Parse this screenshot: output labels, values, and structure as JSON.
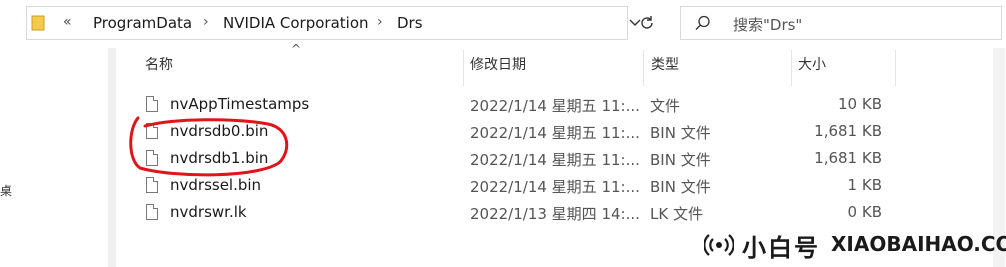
{
  "breadcrumb": {
    "overflow": "«",
    "items": [
      "ProgramData",
      "NVIDIA Corporation",
      "Drs"
    ],
    "separator": "›"
  },
  "search": {
    "placeholder": "搜索\"Drs\""
  },
  "nav": {
    "partial_label": "桌"
  },
  "columns": {
    "name": "名称",
    "date": "修改日期",
    "type": "类型",
    "size": "大小"
  },
  "files": [
    {
      "name": "nvAppTimestamps",
      "date": "2022/1/14 星期五 11:...",
      "type": "文件",
      "size": "10 KB"
    },
    {
      "name": "nvdrsdb0.bin",
      "date": "2022/1/14 星期五 11:...",
      "type": "BIN 文件",
      "size": "1,681 KB"
    },
    {
      "name": "nvdrsdb1.bin",
      "date": "2022/1/14 星期五 11:...",
      "type": "BIN 文件",
      "size": "1,681 KB"
    },
    {
      "name": "nvdrssel.bin",
      "date": "2022/1/14 星期五 11:...",
      "type": "BIN 文件",
      "size": "1 KB"
    },
    {
      "name": "nvdrswr.lk",
      "date": "2022/1/13 星期四 14:...",
      "type": "LK 文件",
      "size": "0 KB"
    }
  ],
  "watermark": {
    "cn": "小白号",
    "en": "XIAOBAIHAO.COM"
  },
  "colors": {
    "annotation": "#e0151b",
    "selection": "#cce8ff"
  }
}
